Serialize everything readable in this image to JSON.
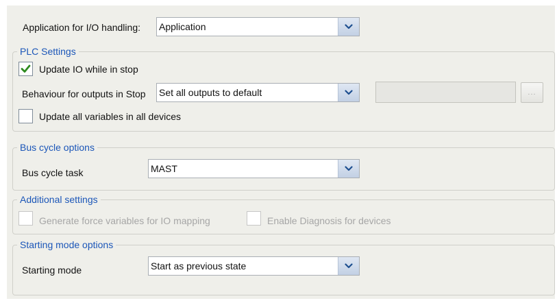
{
  "top": {
    "io_handling_label": "Application for I/O handling:",
    "io_handling_value": "Application"
  },
  "plc_settings": {
    "title": "PLC Settings",
    "update_io_label": "Update IO while in stop",
    "update_io_checked": true,
    "behaviour_label": "Behaviour for outputs in Stop",
    "behaviour_value": "Set all outputs to default",
    "behaviour_extra_value": "",
    "browse_label": "...",
    "update_all_label": "Update all variables in all devices",
    "update_all_checked": false
  },
  "bus_cycle": {
    "title": "Bus cycle options",
    "task_label": "Bus cycle task",
    "task_value": "MAST"
  },
  "additional": {
    "title": "Additional settings",
    "force_vars_label": "Generate force variables for IO mapping",
    "force_vars_checked": false,
    "diagnosis_label": "Enable Diagnosis for devices",
    "diagnosis_checked": false
  },
  "starting_mode": {
    "title": "Starting mode options",
    "mode_label": "Starting mode",
    "mode_value": "Start as previous state"
  },
  "colors": {
    "panel_bg": "#efefea",
    "group_title": "#1b56b8",
    "check_green": "#2e8b1f"
  },
  "icons": {
    "dropdown": "chevron-down-icon",
    "check": "checkmark-icon"
  }
}
